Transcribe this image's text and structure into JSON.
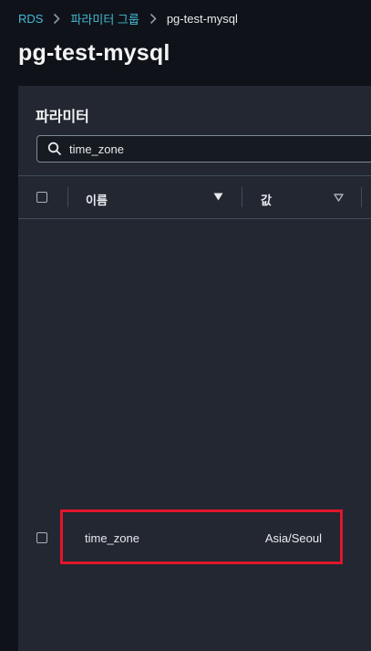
{
  "breadcrumb": {
    "items": [
      "RDS",
      "파라미터 그룹"
    ],
    "current": "pg-test-mysql"
  },
  "page": {
    "title": "pg-test-mysql"
  },
  "parameters": {
    "title": "파라미터",
    "search": {
      "value": "time_zone",
      "icon": "search-icon"
    },
    "columns": [
      {
        "label": "이름",
        "sort": "descending-filled"
      },
      {
        "label": "값",
        "sort": "unsorted-outline"
      }
    ],
    "rows": [
      {
        "name": "time_zone",
        "value": "Asia/Seoul"
      }
    ]
  },
  "colors": {
    "background": "#0f1319",
    "panel": "#222731",
    "link": "#44b9d6",
    "highlight": "#e0162b"
  }
}
